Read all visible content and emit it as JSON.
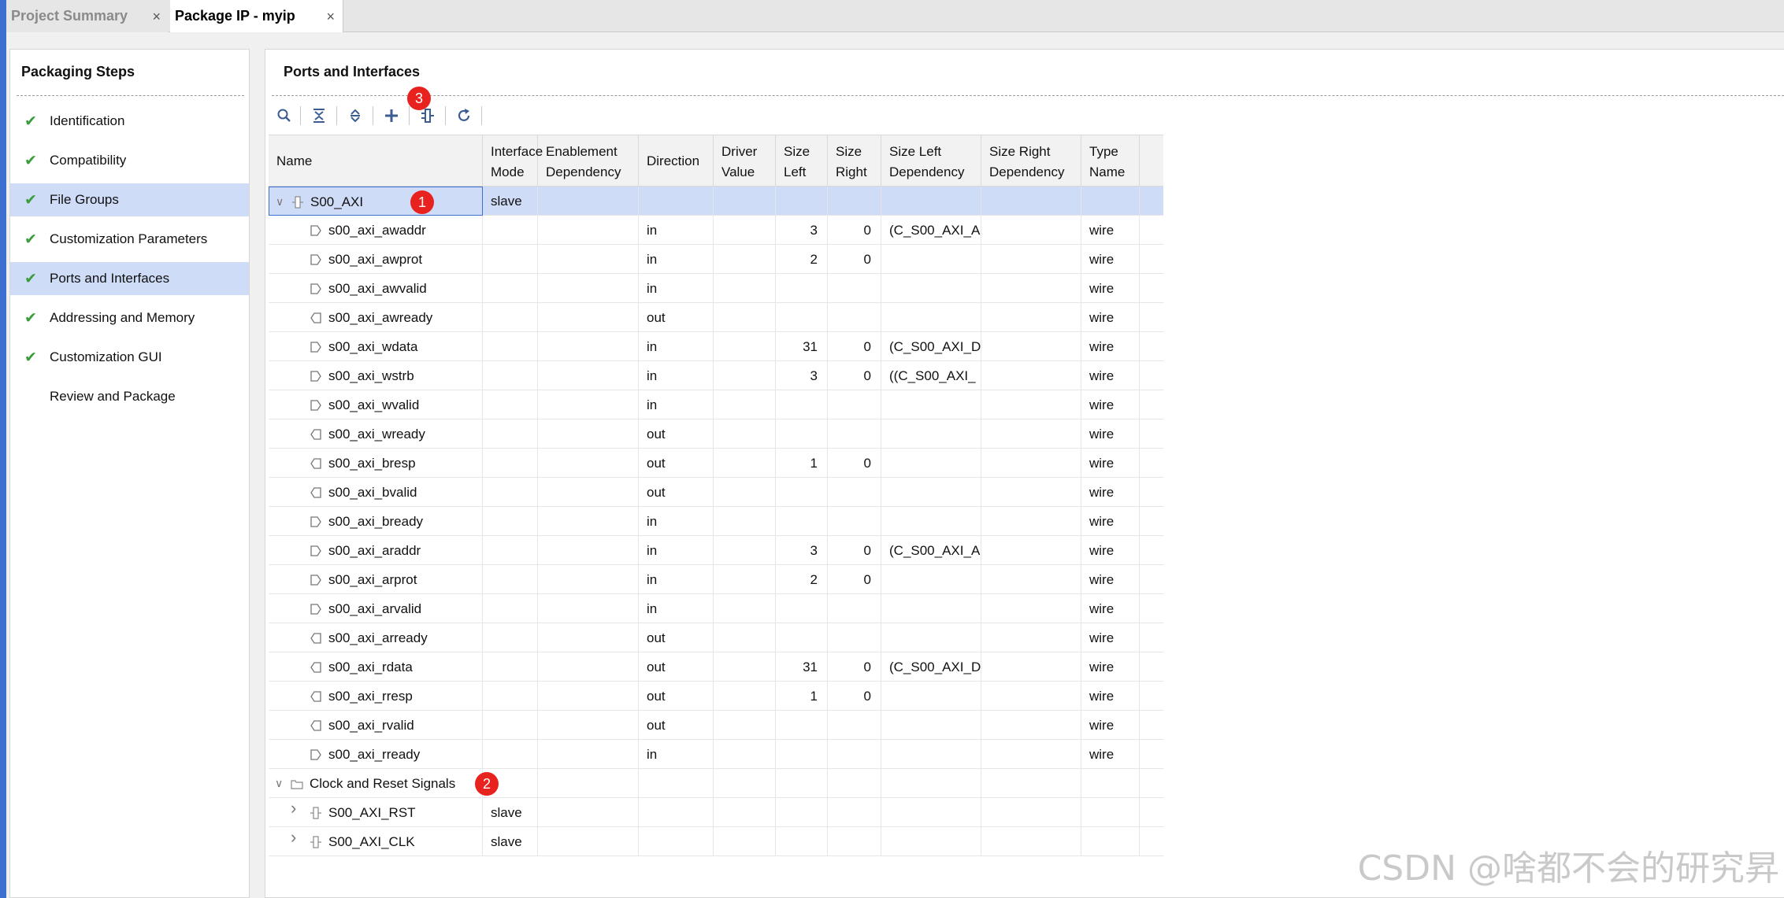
{
  "tabs": [
    {
      "label": "Project Summary",
      "active": false
    },
    {
      "label": "Package IP - myip",
      "active": true
    }
  ],
  "tab_close_glyph": "×",
  "steps_panel": {
    "title": "Packaging Steps",
    "items": [
      {
        "label": "Identification",
        "done": true,
        "selected": false
      },
      {
        "label": "Compatibility",
        "done": true,
        "selected": false
      },
      {
        "label": "File Groups",
        "done": true,
        "selected": true
      },
      {
        "label": "Customization Parameters",
        "done": true,
        "selected": false
      },
      {
        "label": "Ports and Interfaces",
        "done": true,
        "selected": true
      },
      {
        "label": "Addressing and Memory",
        "done": true,
        "selected": false
      },
      {
        "label": "Customization GUI",
        "done": true,
        "selected": false
      },
      {
        "label": "Review and Package",
        "done": false,
        "selected": false
      }
    ]
  },
  "main": {
    "title": "Ports and Interfaces",
    "toolbar": [
      "search-icon",
      "collapse-all-icon",
      "expand-all-icon",
      "add-icon",
      "auto-infer-icon",
      "refresh-icon"
    ]
  },
  "badges": {
    "b1": "1",
    "b2": "2",
    "b3": "3"
  },
  "table": {
    "headers": {
      "name": "Name",
      "interface_mode": [
        "Interface",
        "Mode"
      ],
      "enablement": [
        "Enablement",
        "Dependency"
      ],
      "direction": "Direction",
      "driver_value": [
        "Driver",
        "Value"
      ],
      "size_left": [
        "Size",
        "Left"
      ],
      "size_right": [
        "Size",
        "Right"
      ],
      "size_left_dep": [
        "Size Left",
        "Dependency"
      ],
      "size_right_dep": [
        "Size Right",
        "Dependency"
      ],
      "type_name": [
        "Type",
        "Name"
      ]
    },
    "rows": [
      {
        "kind": "interface",
        "name": "S00_AXI",
        "mode": "slave",
        "dir": "",
        "sl": "",
        "sr": "",
        "sld": "",
        "type": ""
      },
      {
        "kind": "port",
        "name": "s00_axi_awaddr",
        "dir": "in",
        "sl": "3",
        "sr": "0",
        "sld": "(C_S00_AXI_A",
        "type": "wire"
      },
      {
        "kind": "port",
        "name": "s00_axi_awprot",
        "dir": "in",
        "sl": "2",
        "sr": "0",
        "sld": "",
        "type": "wire"
      },
      {
        "kind": "port",
        "name": "s00_axi_awvalid",
        "dir": "in",
        "sl": "",
        "sr": "",
        "sld": "",
        "type": "wire"
      },
      {
        "kind": "port",
        "name": "s00_axi_awready",
        "dir": "out",
        "sl": "",
        "sr": "",
        "sld": "",
        "type": "wire"
      },
      {
        "kind": "port",
        "name": "s00_axi_wdata",
        "dir": "in",
        "sl": "31",
        "sr": "0",
        "sld": "(C_S00_AXI_D",
        "type": "wire"
      },
      {
        "kind": "port",
        "name": "s00_axi_wstrb",
        "dir": "in",
        "sl": "3",
        "sr": "0",
        "sld": "((C_S00_AXI_",
        "type": "wire"
      },
      {
        "kind": "port",
        "name": "s00_axi_wvalid",
        "dir": "in",
        "sl": "",
        "sr": "",
        "sld": "",
        "type": "wire"
      },
      {
        "kind": "port",
        "name": "s00_axi_wready",
        "dir": "out",
        "sl": "",
        "sr": "",
        "sld": "",
        "type": "wire"
      },
      {
        "kind": "port",
        "name": "s00_axi_bresp",
        "dir": "out",
        "sl": "1",
        "sr": "0",
        "sld": "",
        "type": "wire"
      },
      {
        "kind": "port",
        "name": "s00_axi_bvalid",
        "dir": "out",
        "sl": "",
        "sr": "",
        "sld": "",
        "type": "wire"
      },
      {
        "kind": "port",
        "name": "s00_axi_bready",
        "dir": "in",
        "sl": "",
        "sr": "",
        "sld": "",
        "type": "wire"
      },
      {
        "kind": "port",
        "name": "s00_axi_araddr",
        "dir": "in",
        "sl": "3",
        "sr": "0",
        "sld": "(C_S00_AXI_A",
        "type": "wire"
      },
      {
        "kind": "port",
        "name": "s00_axi_arprot",
        "dir": "in",
        "sl": "2",
        "sr": "0",
        "sld": "",
        "type": "wire"
      },
      {
        "kind": "port",
        "name": "s00_axi_arvalid",
        "dir": "in",
        "sl": "",
        "sr": "",
        "sld": "",
        "type": "wire"
      },
      {
        "kind": "port",
        "name": "s00_axi_arready",
        "dir": "out",
        "sl": "",
        "sr": "",
        "sld": "",
        "type": "wire"
      },
      {
        "kind": "port",
        "name": "s00_axi_rdata",
        "dir": "out",
        "sl": "31",
        "sr": "0",
        "sld": "(C_S00_AXI_D",
        "type": "wire"
      },
      {
        "kind": "port",
        "name": "s00_axi_rresp",
        "dir": "out",
        "sl": "1",
        "sr": "0",
        "sld": "",
        "type": "wire"
      },
      {
        "kind": "port",
        "name": "s00_axi_rvalid",
        "dir": "out",
        "sl": "",
        "sr": "",
        "sld": "",
        "type": "wire"
      },
      {
        "kind": "port",
        "name": "s00_axi_rready",
        "dir": "in",
        "sl": "",
        "sr": "",
        "sld": "",
        "type": "wire"
      },
      {
        "kind": "group",
        "name": "Clock and Reset Signals",
        "mode": "",
        "dir": "",
        "sl": "",
        "sr": "",
        "sld": "",
        "type": ""
      },
      {
        "kind": "sub-interface",
        "name": "S00_AXI_RST",
        "mode": "slave",
        "dir": "",
        "sl": "",
        "sr": "",
        "sld": "",
        "type": ""
      },
      {
        "kind": "sub-interface",
        "name": "S00_AXI_CLK",
        "mode": "slave",
        "dir": "",
        "sl": "",
        "sr": "",
        "sld": "",
        "type": ""
      }
    ]
  },
  "watermark": "CSDN @啥都不会的研究昇",
  "colors": {
    "selection": "#cfdcf7",
    "check": "#3a9c3a",
    "badge": "#e8231f",
    "accent": "#3d6fd1"
  }
}
